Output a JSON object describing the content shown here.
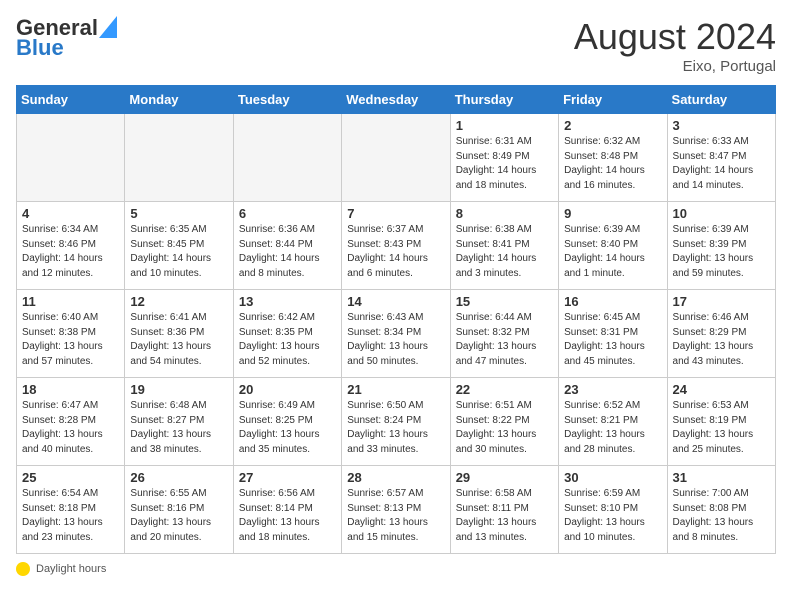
{
  "header": {
    "logo_general": "General",
    "logo_blue": "Blue",
    "month_year": "August 2024",
    "location": "Eixo, Portugal"
  },
  "days_of_week": [
    "Sunday",
    "Monday",
    "Tuesday",
    "Wednesday",
    "Thursday",
    "Friday",
    "Saturday"
  ],
  "weeks": [
    [
      {
        "day": "",
        "text": ""
      },
      {
        "day": "",
        "text": ""
      },
      {
        "day": "",
        "text": ""
      },
      {
        "day": "",
        "text": ""
      },
      {
        "day": "1",
        "text": "Sunrise: 6:31 AM\nSunset: 8:49 PM\nDaylight: 14 hours\nand 18 minutes."
      },
      {
        "day": "2",
        "text": "Sunrise: 6:32 AM\nSunset: 8:48 PM\nDaylight: 14 hours\nand 16 minutes."
      },
      {
        "day": "3",
        "text": "Sunrise: 6:33 AM\nSunset: 8:47 PM\nDaylight: 14 hours\nand 14 minutes."
      }
    ],
    [
      {
        "day": "4",
        "text": "Sunrise: 6:34 AM\nSunset: 8:46 PM\nDaylight: 14 hours\nand 12 minutes."
      },
      {
        "day": "5",
        "text": "Sunrise: 6:35 AM\nSunset: 8:45 PM\nDaylight: 14 hours\nand 10 minutes."
      },
      {
        "day": "6",
        "text": "Sunrise: 6:36 AM\nSunset: 8:44 PM\nDaylight: 14 hours\nand 8 minutes."
      },
      {
        "day": "7",
        "text": "Sunrise: 6:37 AM\nSunset: 8:43 PM\nDaylight: 14 hours\nand 6 minutes."
      },
      {
        "day": "8",
        "text": "Sunrise: 6:38 AM\nSunset: 8:41 PM\nDaylight: 14 hours\nand 3 minutes."
      },
      {
        "day": "9",
        "text": "Sunrise: 6:39 AM\nSunset: 8:40 PM\nDaylight: 14 hours\nand 1 minute."
      },
      {
        "day": "10",
        "text": "Sunrise: 6:39 AM\nSunset: 8:39 PM\nDaylight: 13 hours\nand 59 minutes."
      }
    ],
    [
      {
        "day": "11",
        "text": "Sunrise: 6:40 AM\nSunset: 8:38 PM\nDaylight: 13 hours\nand 57 minutes."
      },
      {
        "day": "12",
        "text": "Sunrise: 6:41 AM\nSunset: 8:36 PM\nDaylight: 13 hours\nand 54 minutes."
      },
      {
        "day": "13",
        "text": "Sunrise: 6:42 AM\nSunset: 8:35 PM\nDaylight: 13 hours\nand 52 minutes."
      },
      {
        "day": "14",
        "text": "Sunrise: 6:43 AM\nSunset: 8:34 PM\nDaylight: 13 hours\nand 50 minutes."
      },
      {
        "day": "15",
        "text": "Sunrise: 6:44 AM\nSunset: 8:32 PM\nDaylight: 13 hours\nand 47 minutes."
      },
      {
        "day": "16",
        "text": "Sunrise: 6:45 AM\nSunset: 8:31 PM\nDaylight: 13 hours\nand 45 minutes."
      },
      {
        "day": "17",
        "text": "Sunrise: 6:46 AM\nSunset: 8:29 PM\nDaylight: 13 hours\nand 43 minutes."
      }
    ],
    [
      {
        "day": "18",
        "text": "Sunrise: 6:47 AM\nSunset: 8:28 PM\nDaylight: 13 hours\nand 40 minutes."
      },
      {
        "day": "19",
        "text": "Sunrise: 6:48 AM\nSunset: 8:27 PM\nDaylight: 13 hours\nand 38 minutes."
      },
      {
        "day": "20",
        "text": "Sunrise: 6:49 AM\nSunset: 8:25 PM\nDaylight: 13 hours\nand 35 minutes."
      },
      {
        "day": "21",
        "text": "Sunrise: 6:50 AM\nSunset: 8:24 PM\nDaylight: 13 hours\nand 33 minutes."
      },
      {
        "day": "22",
        "text": "Sunrise: 6:51 AM\nSunset: 8:22 PM\nDaylight: 13 hours\nand 30 minutes."
      },
      {
        "day": "23",
        "text": "Sunrise: 6:52 AM\nSunset: 8:21 PM\nDaylight: 13 hours\nand 28 minutes."
      },
      {
        "day": "24",
        "text": "Sunrise: 6:53 AM\nSunset: 8:19 PM\nDaylight: 13 hours\nand 25 minutes."
      }
    ],
    [
      {
        "day": "25",
        "text": "Sunrise: 6:54 AM\nSunset: 8:18 PM\nDaylight: 13 hours\nand 23 minutes."
      },
      {
        "day": "26",
        "text": "Sunrise: 6:55 AM\nSunset: 8:16 PM\nDaylight: 13 hours\nand 20 minutes."
      },
      {
        "day": "27",
        "text": "Sunrise: 6:56 AM\nSunset: 8:14 PM\nDaylight: 13 hours\nand 18 minutes."
      },
      {
        "day": "28",
        "text": "Sunrise: 6:57 AM\nSunset: 8:13 PM\nDaylight: 13 hours\nand 15 minutes."
      },
      {
        "day": "29",
        "text": "Sunrise: 6:58 AM\nSunset: 8:11 PM\nDaylight: 13 hours\nand 13 minutes."
      },
      {
        "day": "30",
        "text": "Sunrise: 6:59 AM\nSunset: 8:10 PM\nDaylight: 13 hours\nand 10 minutes."
      },
      {
        "day": "31",
        "text": "Sunrise: 7:00 AM\nSunset: 8:08 PM\nDaylight: 13 hours\nand 8 minutes."
      }
    ]
  ],
  "footer": {
    "label": "Daylight hours"
  }
}
